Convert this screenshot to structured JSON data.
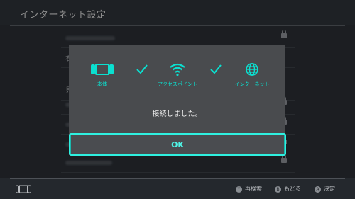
{
  "header": {
    "title": "インターネット設定"
  },
  "background": {
    "row_fragment_1": "有",
    "row_fragment_2": "見"
  },
  "dialog": {
    "steps": [
      {
        "label": "本体",
        "icon": "switch-console-icon"
      },
      {
        "label": "アクセスポイント",
        "icon": "wifi-icon"
      },
      {
        "label": "インターネット",
        "icon": "globe-icon"
      }
    ],
    "message": "接続しました。",
    "ok_label": "OK"
  },
  "footer": {
    "hints": [
      {
        "button": "Y",
        "label": "再検索"
      },
      {
        "button": "B",
        "label": "もどる"
      },
      {
        "button": "A",
        "label": "決定"
      }
    ]
  },
  "colors": {
    "accent": "#2ff0e0",
    "dialog_bg": "#494b4e",
    "page_bg": "#2b2f35"
  }
}
